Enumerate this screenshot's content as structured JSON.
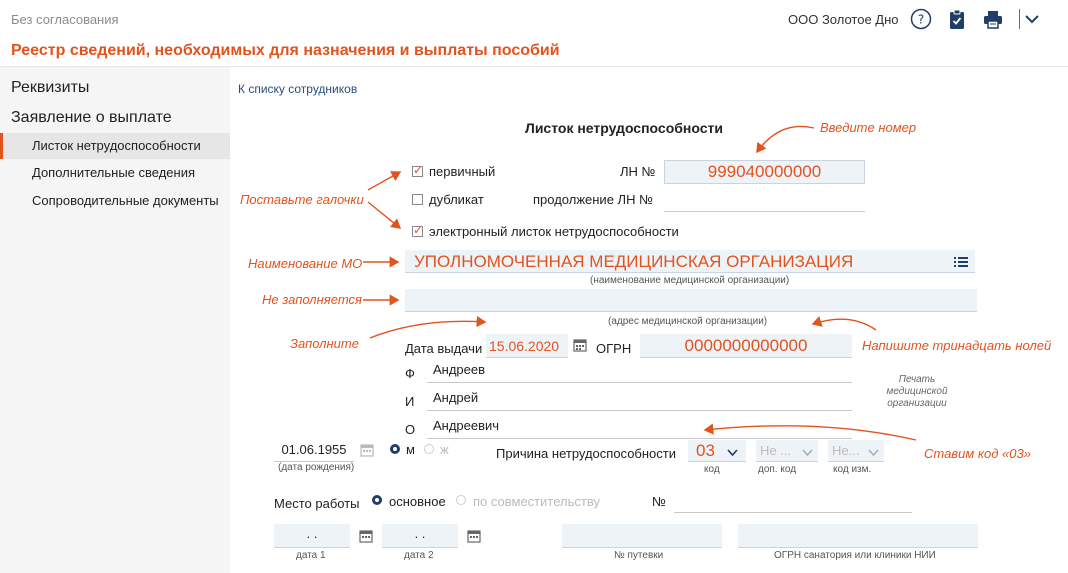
{
  "header": {
    "status": "Без согласования",
    "company": "ООО Золотое Дно",
    "title": "Реестр сведений, необходимых для назначения и выплаты пособий",
    "icons": [
      "help-icon",
      "clipboard-icon",
      "print-icon",
      "chevron-down-icon"
    ]
  },
  "sidebar": {
    "rekvizity": "Реквизиты",
    "zayavlenie": "Заявление о выплате",
    "items": [
      {
        "label": "Листок нетрудоспособности",
        "active": true
      },
      {
        "label": "Дополнительные сведения",
        "active": false
      },
      {
        "label": "Сопроводительные документы",
        "active": false
      }
    ]
  },
  "main": {
    "back_link": "К списку сотрудников",
    "form_title": "Листок нетрудоспособности",
    "checkboxes": {
      "primary": {
        "label": "первичный",
        "checked": true
      },
      "duplicate": {
        "label": "дубликат",
        "checked": false
      },
      "electronic": {
        "label": "электронный листок нетрудоспособности",
        "checked": true
      }
    },
    "ln_label": "ЛН №",
    "ln_value": "999040000000",
    "continuation_label": "продолжение ЛН №",
    "continuation_value": "",
    "mo_name": "УПОЛНОМОЧЕННАЯ МЕДИЦИНСКАЯ ОРГАНИЗАЦИЯ",
    "mo_name_caption": "(наименование медицинской организации)",
    "mo_address": "",
    "mo_address_caption": "(адрес медицинской организации)",
    "issue_date_label": "Дата выдачи",
    "issue_date": "15.06.2020",
    "ogrn_label": "ОГРН",
    "ogrn_value": "0000000000000",
    "fio": {
      "f_label": "Ф",
      "f_value": "Андреев",
      "i_label": "И",
      "i_value": "Андрей",
      "o_label": "О",
      "o_value": "Андреевич"
    },
    "stamp_text": [
      "Печать",
      "медицинской",
      "организации"
    ],
    "birth_date": "01.06.1955",
    "birth_caption": "(дата рождения)",
    "gender_m": "м",
    "gender_f": "ж",
    "gender_selected": "м",
    "reason_label": "Причина нетрудоспособности",
    "reason_code": "03",
    "reason_code_caption": "код",
    "extra_code": "Не ...",
    "extra_code_caption": "доп. код",
    "change_code": "Не...",
    "change_code_caption": "код изм.",
    "workplace_label": "Место работы",
    "workplace_main": "основное",
    "workplace_part": "по совместительству",
    "workplace_selected": "основное",
    "number_label": "№",
    "date1_value": ".  .",
    "date1_caption": "дата 1",
    "date2_value": ".  .",
    "date2_caption": "дата 2",
    "voucher_caption": "№ путевки",
    "sanatorium_caption": "ОГРН санатория или клиники НИИ"
  },
  "annotations": {
    "enter_number": "Введите номер",
    "set_checks": "Поставьте галочки",
    "mo_name": "Наименование МО",
    "not_filled": "Не заполняется",
    "fill": "Заполните",
    "thirteen_zeros": "Напишите тринадцать нолей",
    "code_03": "Ставим код «03»"
  },
  "colors": {
    "accent": "#e2531e",
    "navy": "#1f3f66",
    "field_bg": "#eef3f8"
  }
}
